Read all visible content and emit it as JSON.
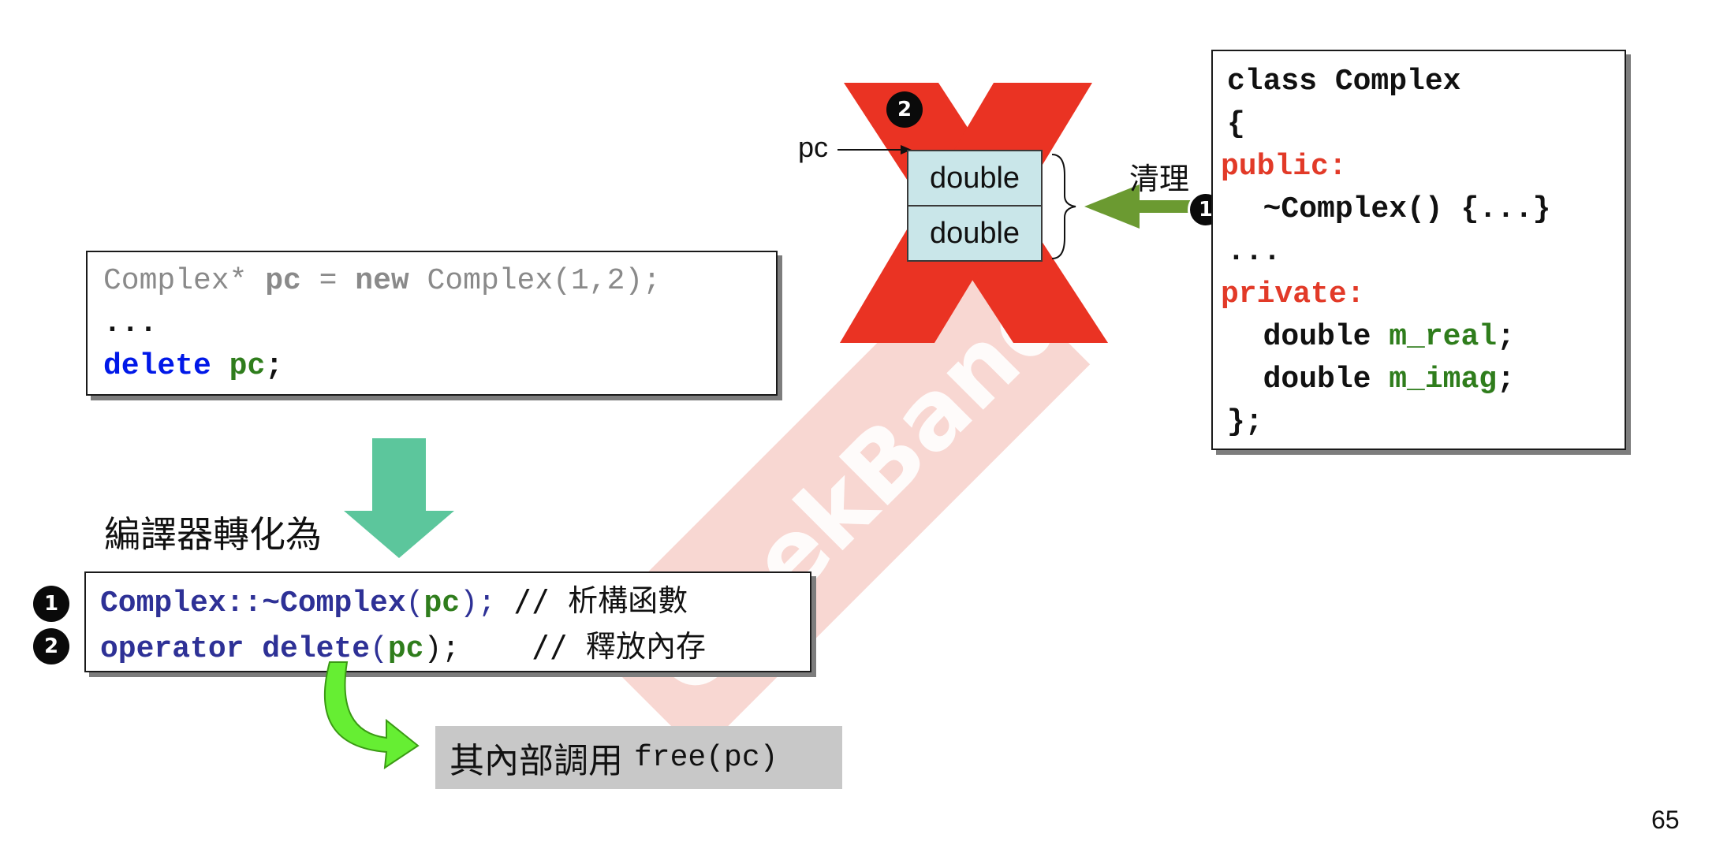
{
  "watermark": {
    "text": "GeekBand 極客班"
  },
  "code_top": {
    "line1": {
      "type": "Complex*",
      "var": "pc",
      "eq": "=",
      "kw_new": "new",
      "ctor": "Complex(1,2);"
    },
    "line2": "...",
    "line3": {
      "kw_delete": "delete",
      "var": "pc",
      "semi": ";"
    }
  },
  "compiler_label": "編譯器轉化為",
  "code_translated": {
    "row1": {
      "badge": "1",
      "call": "Complex::~Complex",
      "open": "(",
      "arg": "pc",
      "close": ");",
      "comment": "// 析構函數"
    },
    "row2": {
      "badge": "2",
      "call": "operator delete",
      "open": "(",
      "arg": "pc",
      "close": ");",
      "comment": "// 釋放內存"
    }
  },
  "free_note": {
    "text": "其內部調用",
    "code": "free(pc)"
  },
  "memory": {
    "pointer_label": "pc",
    "cells": [
      "double",
      "double"
    ],
    "badge": "2",
    "cleanup_label": "清理",
    "cleanup_badge": "1"
  },
  "class_code": {
    "l1": "class Complex",
    "l2": "{",
    "l3": "public:",
    "l4": "  ~Complex() {...}",
    "l5": "...",
    "l6": "private:",
    "l7a": "  double ",
    "l7b": "m_real",
    "l7c": ";",
    "l8a": "  double ",
    "l8b": "m_imag",
    "l8c": ";",
    "l9": "};"
  },
  "page_number": "65",
  "colors": {
    "cross_red": "#ea3323",
    "arrow_teal": "#5cc69c",
    "arrow_green": "#6b9a31",
    "curve_arrow": "#66ee33",
    "cell_fill": "#c9e6e9",
    "note_gray": "#c8c8c8"
  }
}
